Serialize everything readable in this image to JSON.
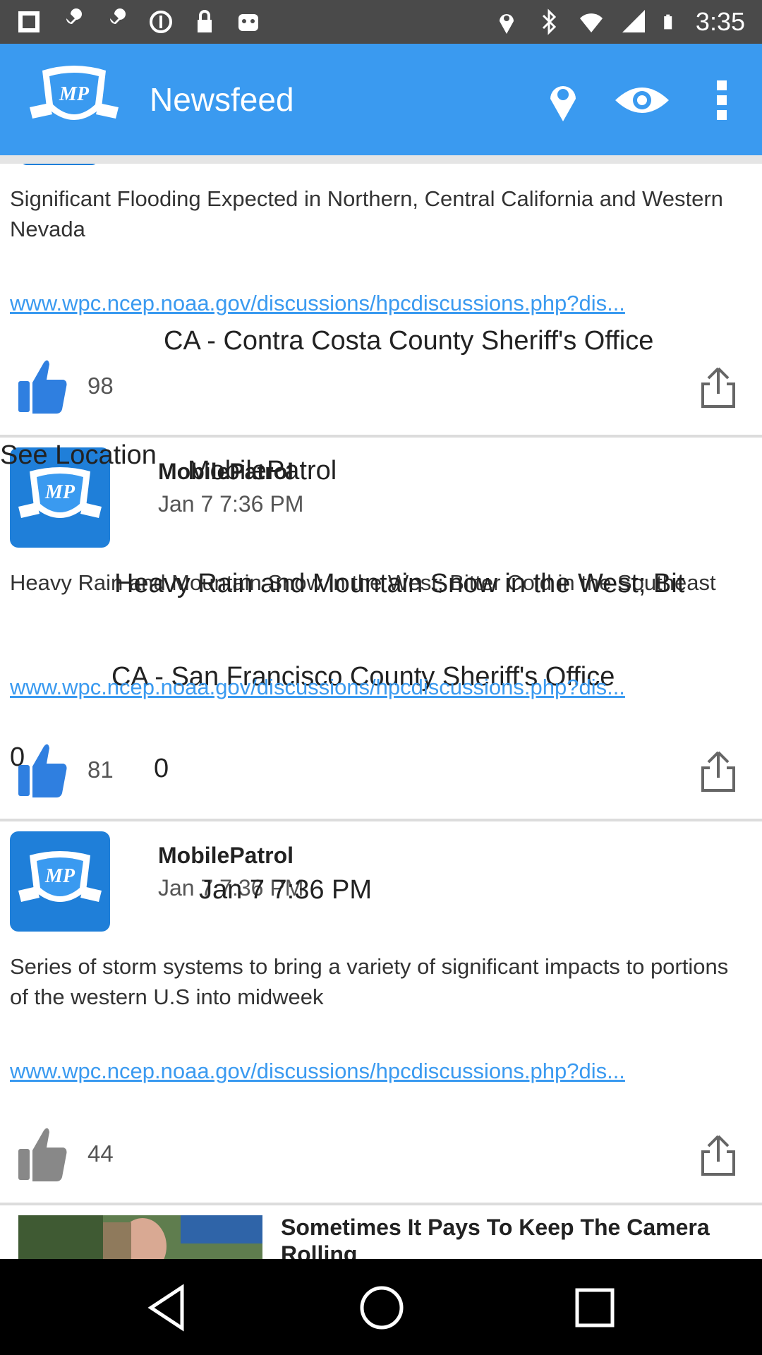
{
  "status_bar": {
    "time": "3:35",
    "left_icons": [
      "photos-icon",
      "wrench-icon",
      "wrench-icon",
      "sync-icon",
      "lock-icon",
      "android-icon"
    ],
    "right_icons": [
      "location-icon",
      "bluetooth-icon",
      "wifi-icon",
      "signal-icon",
      "battery-icon"
    ]
  },
  "app_bar": {
    "title": "Newsfeed",
    "accent": "#3a9af0"
  },
  "posts": [
    {
      "text": "Significant Flooding Expected in Northern, Central California and Western Nevada",
      "link": "www.wpc.ncep.noaa.gov/discussions/hpcdiscussions.php?dis...",
      "overlay_office": "CA - Contra Costa County Sheriff's Office",
      "likes": "98"
    },
    {
      "overlay_location": "See Location",
      "author": "MobilePatrol",
      "overlay_author": "MobilePatrol",
      "date": "Jan 7 7:36 PM",
      "text": "Heavy Rain and Mountain Snow in the West; Bitter Cold in the Southeast",
      "overlay_text": "Heavy Rain and Mountain Snow in the West; Bit",
      "link": "www.wpc.ncep.noaa.gov/discussions/hpcdiscussions.php?dis...",
      "overlay_office": "CA - San Francisco County Sheriff's Office",
      "overlay_zero_left": "0",
      "overlay_zero": "0",
      "likes": "81"
    },
    {
      "author": "MobilePatrol",
      "date": "Jan 7 7:36 PM",
      "overlay_date": "Jan 7 7:36 PM",
      "text": "Series of storm systems to bring a variety of significant impacts to portions of the western U.S into midweek",
      "link": "www.wpc.ncep.noaa.gov/discussions/hpcdiscussions.php?dis...",
      "likes": "44"
    }
  ],
  "ad": {
    "title": "Sometimes It Pays To Keep The Camera Rolling"
  }
}
